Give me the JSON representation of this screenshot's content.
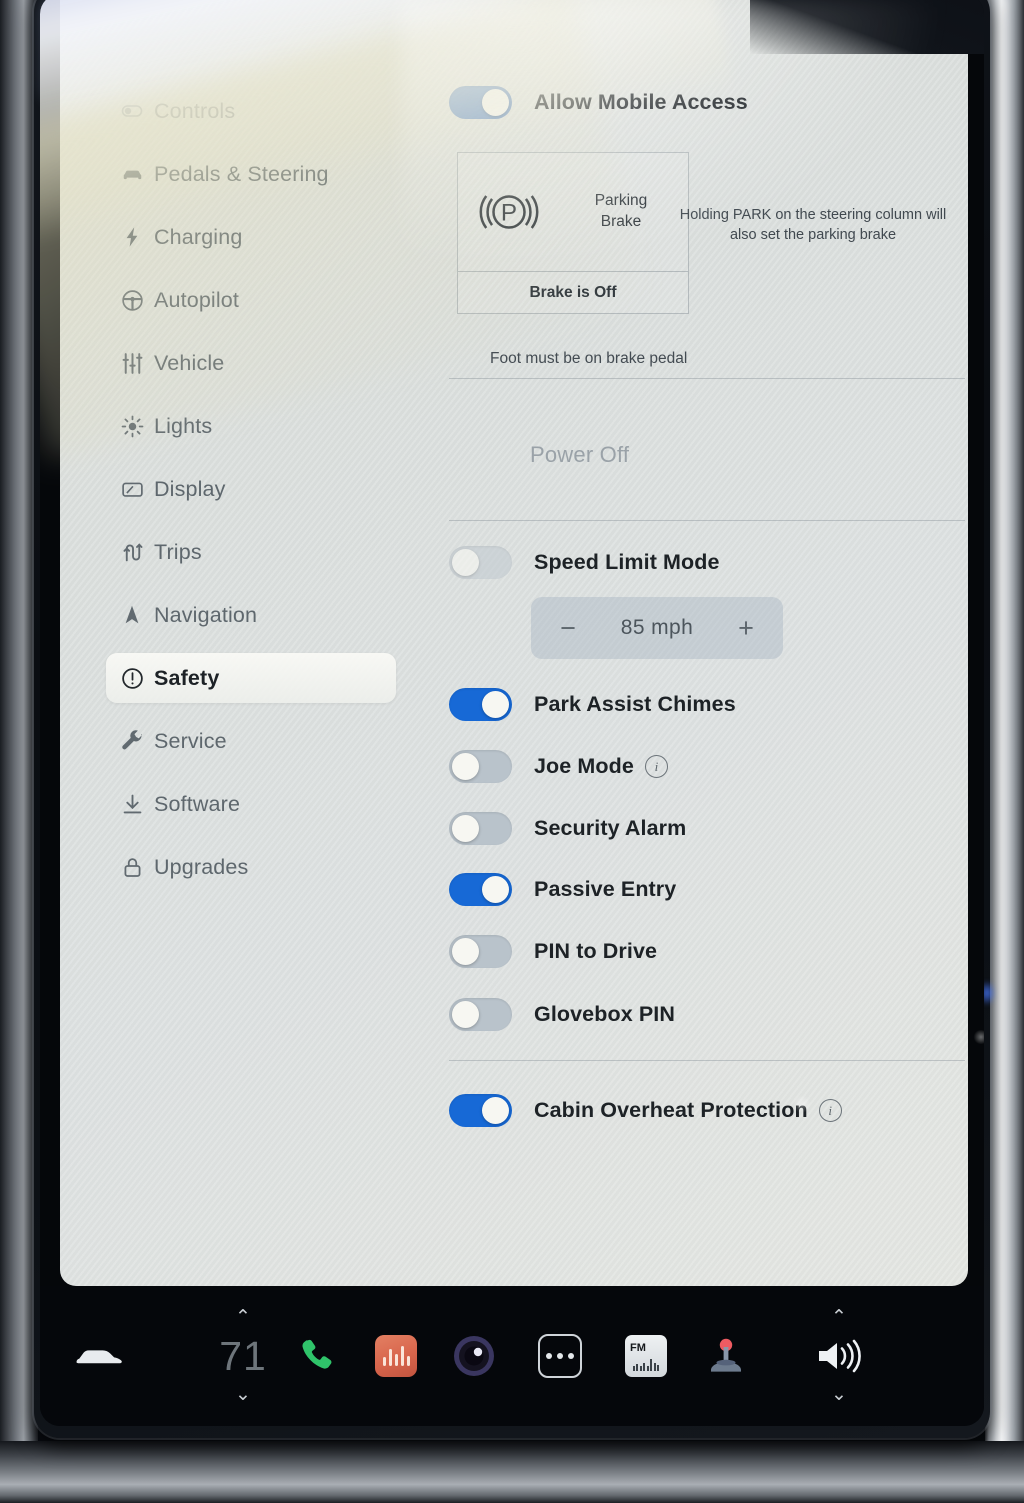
{
  "sidebar": {
    "items": [
      {
        "label": "Controls",
        "icon": "toggle-icon",
        "selected": false,
        "faded": true
      },
      {
        "label": "Pedals & Steering",
        "icon": "car-front-icon",
        "selected": false,
        "faded": false
      },
      {
        "label": "Charging",
        "icon": "bolt-icon",
        "selected": false,
        "faded": false
      },
      {
        "label": "Autopilot",
        "icon": "steering-wheel-icon",
        "selected": false,
        "faded": false
      },
      {
        "label": "Vehicle",
        "icon": "sliders-icon",
        "selected": false,
        "faded": false
      },
      {
        "label": "Lights",
        "icon": "sun-icon",
        "selected": false,
        "faded": false
      },
      {
        "label": "Display",
        "icon": "display-icon",
        "selected": false,
        "faded": false
      },
      {
        "label": "Trips",
        "icon": "trips-icon",
        "selected": false,
        "faded": false
      },
      {
        "label": "Navigation",
        "icon": "navigation-arrow-icon",
        "selected": false,
        "faded": false
      },
      {
        "label": "Safety",
        "icon": "exclamation-circle-icon",
        "selected": true,
        "faded": false
      },
      {
        "label": "Service",
        "icon": "wrench-icon",
        "selected": false,
        "faded": false
      },
      {
        "label": "Software",
        "icon": "download-icon",
        "selected": false,
        "faded": false
      },
      {
        "label": "Upgrades",
        "icon": "lock-icon",
        "selected": false,
        "faded": false
      }
    ]
  },
  "main": {
    "mobile_access": {
      "label": "Allow Mobile Access",
      "state": "on"
    },
    "parking_brake": {
      "symbol": "parking-brake-icon",
      "title_line1": "Parking",
      "title_line2": "Brake",
      "status": "Brake is Off",
      "hint": "Holding PARK on the steering column will also set the parking brake",
      "footnote": "Foot must be on brake pedal"
    },
    "power_off": {
      "label": "Power Off",
      "state": "disabled"
    },
    "speed_limit": {
      "label": "Speed Limit Mode",
      "state": "off",
      "value": "85  mph",
      "minus": "−",
      "plus": "+"
    },
    "toggles": [
      {
        "label": "Park Assist Chimes",
        "state": "on",
        "info": false
      },
      {
        "label": "Joe Mode",
        "state": "off",
        "info": true
      },
      {
        "label": "Security Alarm",
        "state": "off",
        "info": false
      },
      {
        "label": "Passive Entry",
        "state": "on",
        "info": false
      },
      {
        "label": "PIN to Drive",
        "state": "off",
        "info": false
      },
      {
        "label": "Glovebox PIN",
        "state": "off",
        "info": false
      }
    ],
    "cabin_overheat": {
      "label": "Cabin Overheat Protection",
      "state": "on",
      "info": true
    },
    "info_glyph": "i"
  },
  "dock": {
    "car_icon": "car-icon",
    "temperature": "71",
    "temp_up": "⌃",
    "temp_down": "⌄",
    "phone_icon": "phone-icon",
    "media_icon": "media-waveform-icon",
    "camera_icon": "camera-icon",
    "more_icon": "more-dots-icon",
    "fm_label": "FM",
    "fm_icon": "fm-radio-icon",
    "arcade_icon": "joystick-icon",
    "volume_icon": "speaker-volume-icon",
    "vol_up": "⌃",
    "vol_down": "⌄"
  },
  "colors": {
    "toggle_on": "#1769d6",
    "toggle_off": "#b9c3cb",
    "panel_bg": "#e0e3e0",
    "dock_bg": "#05070b",
    "text_primary": "#1d2226",
    "text_muted": "#5e676d",
    "media_tile": "#d8654c",
    "phone_green": "#2fc36a"
  }
}
